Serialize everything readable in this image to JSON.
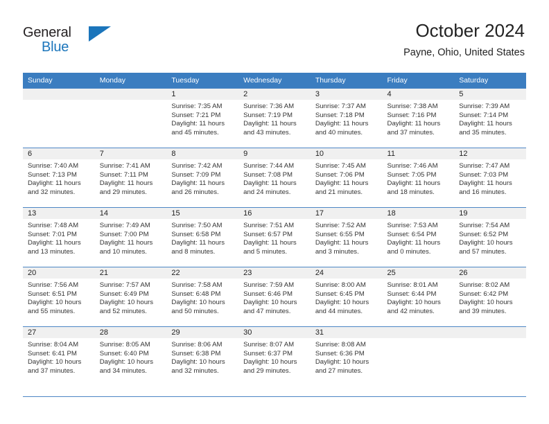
{
  "brand": {
    "name_part1": "General",
    "name_part2": "Blue",
    "logo_icon": "triangle-icon"
  },
  "header": {
    "title": "October 2024",
    "subtitle": "Payne, Ohio, United States"
  },
  "weekday_headers": [
    "Sunday",
    "Monday",
    "Tuesday",
    "Wednesday",
    "Thursday",
    "Friday",
    "Saturday"
  ],
  "colors": {
    "header_bar": "#3b7dc0",
    "grid_line": "#4b85c4",
    "daynum_band": "#f0f0f0",
    "brand_blue": "#1b75bb",
    "text": "#333333"
  },
  "labels": {
    "sunrise_prefix": "Sunrise:",
    "sunset_prefix": "Sunset:",
    "daylight_prefix": "Daylight:"
  },
  "weeks": [
    [
      {
        "blank": true
      },
      {
        "blank": true
      },
      {
        "day": "1",
        "sunrise": "Sunrise: 7:35 AM",
        "sunset": "Sunset: 7:21 PM",
        "daylight1": "Daylight: 11 hours",
        "daylight2": "and 45 minutes."
      },
      {
        "day": "2",
        "sunrise": "Sunrise: 7:36 AM",
        "sunset": "Sunset: 7:19 PM",
        "daylight1": "Daylight: 11 hours",
        "daylight2": "and 43 minutes."
      },
      {
        "day": "3",
        "sunrise": "Sunrise: 7:37 AM",
        "sunset": "Sunset: 7:18 PM",
        "daylight1": "Daylight: 11 hours",
        "daylight2": "and 40 minutes."
      },
      {
        "day": "4",
        "sunrise": "Sunrise: 7:38 AM",
        "sunset": "Sunset: 7:16 PM",
        "daylight1": "Daylight: 11 hours",
        "daylight2": "and 37 minutes."
      },
      {
        "day": "5",
        "sunrise": "Sunrise: 7:39 AM",
        "sunset": "Sunset: 7:14 PM",
        "daylight1": "Daylight: 11 hours",
        "daylight2": "and 35 minutes."
      }
    ],
    [
      {
        "day": "6",
        "sunrise": "Sunrise: 7:40 AM",
        "sunset": "Sunset: 7:13 PM",
        "daylight1": "Daylight: 11 hours",
        "daylight2": "and 32 minutes."
      },
      {
        "day": "7",
        "sunrise": "Sunrise: 7:41 AM",
        "sunset": "Sunset: 7:11 PM",
        "daylight1": "Daylight: 11 hours",
        "daylight2": "and 29 minutes."
      },
      {
        "day": "8",
        "sunrise": "Sunrise: 7:42 AM",
        "sunset": "Sunset: 7:09 PM",
        "daylight1": "Daylight: 11 hours",
        "daylight2": "and 26 minutes."
      },
      {
        "day": "9",
        "sunrise": "Sunrise: 7:44 AM",
        "sunset": "Sunset: 7:08 PM",
        "daylight1": "Daylight: 11 hours",
        "daylight2": "and 24 minutes."
      },
      {
        "day": "10",
        "sunrise": "Sunrise: 7:45 AM",
        "sunset": "Sunset: 7:06 PM",
        "daylight1": "Daylight: 11 hours",
        "daylight2": "and 21 minutes."
      },
      {
        "day": "11",
        "sunrise": "Sunrise: 7:46 AM",
        "sunset": "Sunset: 7:05 PM",
        "daylight1": "Daylight: 11 hours",
        "daylight2": "and 18 minutes."
      },
      {
        "day": "12",
        "sunrise": "Sunrise: 7:47 AM",
        "sunset": "Sunset: 7:03 PM",
        "daylight1": "Daylight: 11 hours",
        "daylight2": "and 16 minutes."
      }
    ],
    [
      {
        "day": "13",
        "sunrise": "Sunrise: 7:48 AM",
        "sunset": "Sunset: 7:01 PM",
        "daylight1": "Daylight: 11 hours",
        "daylight2": "and 13 minutes."
      },
      {
        "day": "14",
        "sunrise": "Sunrise: 7:49 AM",
        "sunset": "Sunset: 7:00 PM",
        "daylight1": "Daylight: 11 hours",
        "daylight2": "and 10 minutes."
      },
      {
        "day": "15",
        "sunrise": "Sunrise: 7:50 AM",
        "sunset": "Sunset: 6:58 PM",
        "daylight1": "Daylight: 11 hours",
        "daylight2": "and 8 minutes."
      },
      {
        "day": "16",
        "sunrise": "Sunrise: 7:51 AM",
        "sunset": "Sunset: 6:57 PM",
        "daylight1": "Daylight: 11 hours",
        "daylight2": "and 5 minutes."
      },
      {
        "day": "17",
        "sunrise": "Sunrise: 7:52 AM",
        "sunset": "Sunset: 6:55 PM",
        "daylight1": "Daylight: 11 hours",
        "daylight2": "and 3 minutes."
      },
      {
        "day": "18",
        "sunrise": "Sunrise: 7:53 AM",
        "sunset": "Sunset: 6:54 PM",
        "daylight1": "Daylight: 11 hours",
        "daylight2": "and 0 minutes."
      },
      {
        "day": "19",
        "sunrise": "Sunrise: 7:54 AM",
        "sunset": "Sunset: 6:52 PM",
        "daylight1": "Daylight: 10 hours",
        "daylight2": "and 57 minutes."
      }
    ],
    [
      {
        "day": "20",
        "sunrise": "Sunrise: 7:56 AM",
        "sunset": "Sunset: 6:51 PM",
        "daylight1": "Daylight: 10 hours",
        "daylight2": "and 55 minutes."
      },
      {
        "day": "21",
        "sunrise": "Sunrise: 7:57 AM",
        "sunset": "Sunset: 6:49 PM",
        "daylight1": "Daylight: 10 hours",
        "daylight2": "and 52 minutes."
      },
      {
        "day": "22",
        "sunrise": "Sunrise: 7:58 AM",
        "sunset": "Sunset: 6:48 PM",
        "daylight1": "Daylight: 10 hours",
        "daylight2": "and 50 minutes."
      },
      {
        "day": "23",
        "sunrise": "Sunrise: 7:59 AM",
        "sunset": "Sunset: 6:46 PM",
        "daylight1": "Daylight: 10 hours",
        "daylight2": "and 47 minutes."
      },
      {
        "day": "24",
        "sunrise": "Sunrise: 8:00 AM",
        "sunset": "Sunset: 6:45 PM",
        "daylight1": "Daylight: 10 hours",
        "daylight2": "and 44 minutes."
      },
      {
        "day": "25",
        "sunrise": "Sunrise: 8:01 AM",
        "sunset": "Sunset: 6:44 PM",
        "daylight1": "Daylight: 10 hours",
        "daylight2": "and 42 minutes."
      },
      {
        "day": "26",
        "sunrise": "Sunrise: 8:02 AM",
        "sunset": "Sunset: 6:42 PM",
        "daylight1": "Daylight: 10 hours",
        "daylight2": "and 39 minutes."
      }
    ],
    [
      {
        "day": "27",
        "sunrise": "Sunrise: 8:04 AM",
        "sunset": "Sunset: 6:41 PM",
        "daylight1": "Daylight: 10 hours",
        "daylight2": "and 37 minutes."
      },
      {
        "day": "28",
        "sunrise": "Sunrise: 8:05 AM",
        "sunset": "Sunset: 6:40 PM",
        "daylight1": "Daylight: 10 hours",
        "daylight2": "and 34 minutes."
      },
      {
        "day": "29",
        "sunrise": "Sunrise: 8:06 AM",
        "sunset": "Sunset: 6:38 PM",
        "daylight1": "Daylight: 10 hours",
        "daylight2": "and 32 minutes."
      },
      {
        "day": "30",
        "sunrise": "Sunrise: 8:07 AM",
        "sunset": "Sunset: 6:37 PM",
        "daylight1": "Daylight: 10 hours",
        "daylight2": "and 29 minutes."
      },
      {
        "day": "31",
        "sunrise": "Sunrise: 8:08 AM",
        "sunset": "Sunset: 6:36 PM",
        "daylight1": "Daylight: 10 hours",
        "daylight2": "and 27 minutes."
      },
      {
        "blank": true
      },
      {
        "blank": true
      }
    ]
  ]
}
